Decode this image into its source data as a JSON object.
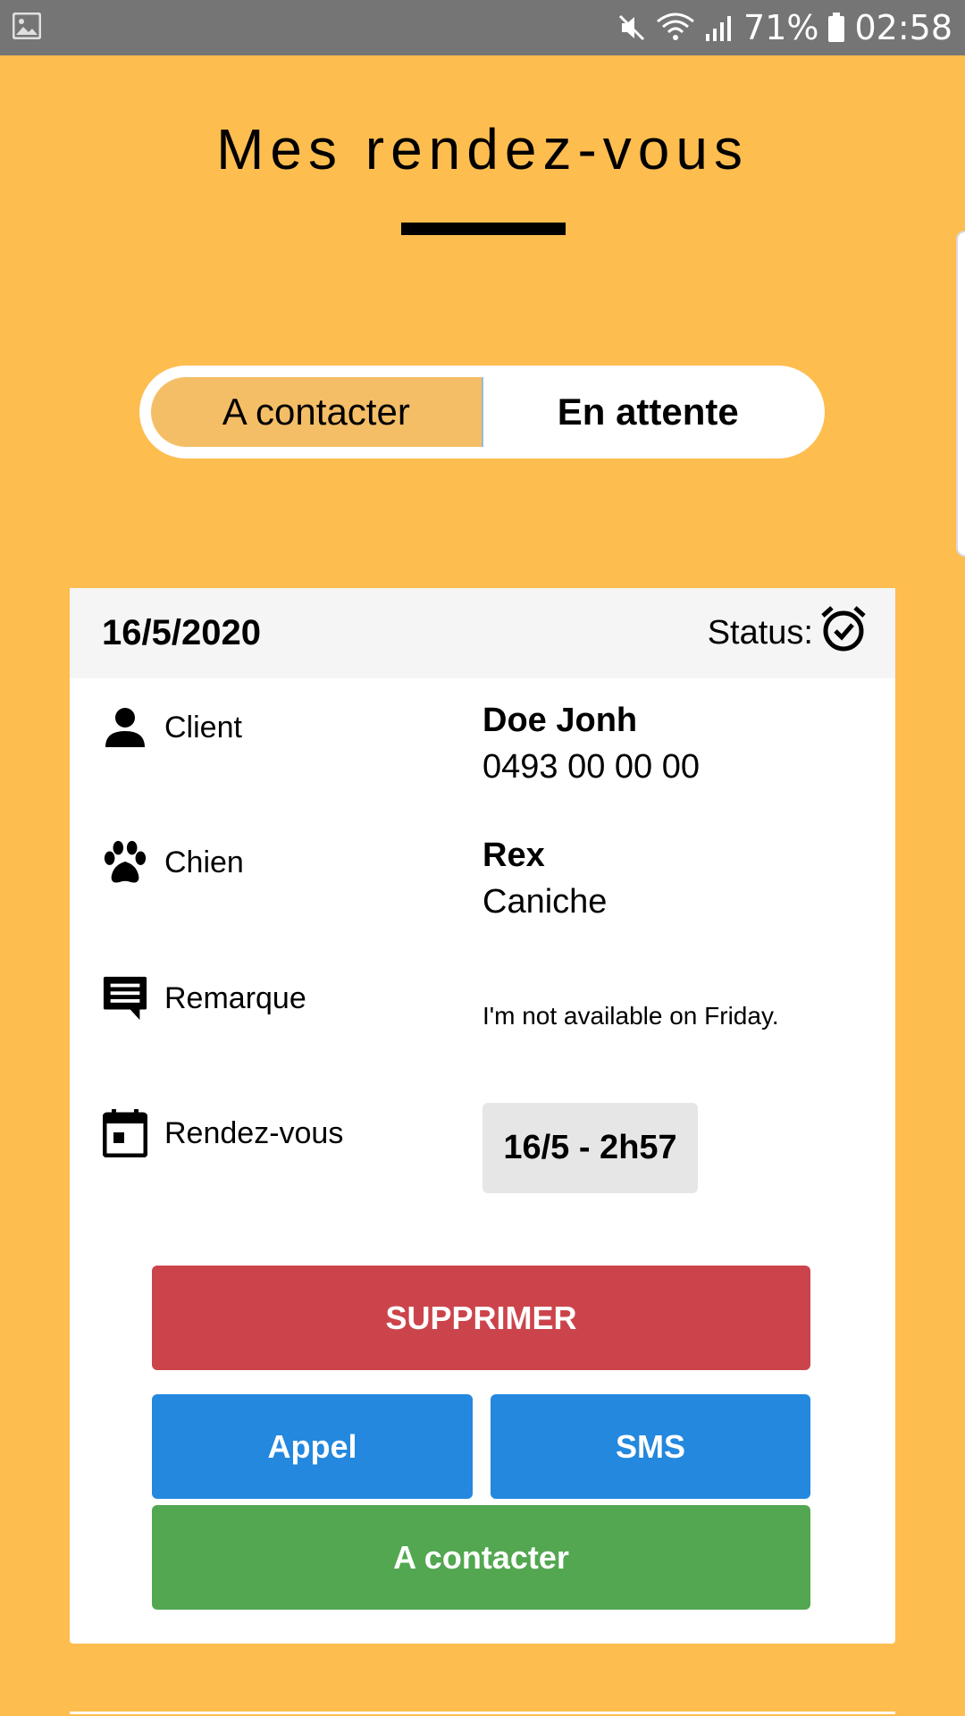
{
  "status_bar": {
    "battery": "71%",
    "time": "02:58",
    "icons": [
      "image-notification-icon",
      "mute-icon",
      "wifi-icon",
      "signal-icon",
      "battery-icon"
    ]
  },
  "page": {
    "title": "Mes rendez-vous"
  },
  "toggle": {
    "options": [
      {
        "label": "A contacter",
        "active": true
      },
      {
        "label": "En attente",
        "active": false
      }
    ]
  },
  "card": {
    "date": "16/5/2020",
    "status_label": "Status:",
    "status_icon": "alarm-check-icon",
    "client": {
      "label": "Client",
      "name": "Doe Jonh",
      "phone": "0493 00 00 00"
    },
    "dog": {
      "label": "Chien",
      "name": "Rex",
      "breed": "Caniche"
    },
    "remark": {
      "label": "Remarque",
      "text": "I'm not available on Friday."
    },
    "appointment": {
      "label": "Rendez-vous",
      "value": "16/5 - 2h57"
    },
    "buttons": {
      "delete": "SUPPRIMER",
      "call": "Appel",
      "sms": "SMS",
      "contact": "A contacter"
    }
  },
  "colors": {
    "background": "#FEBD4F",
    "delete": "#CC444B",
    "call": "#2388DE",
    "contact": "#52A750",
    "toggle_active": "#F4BE67"
  }
}
